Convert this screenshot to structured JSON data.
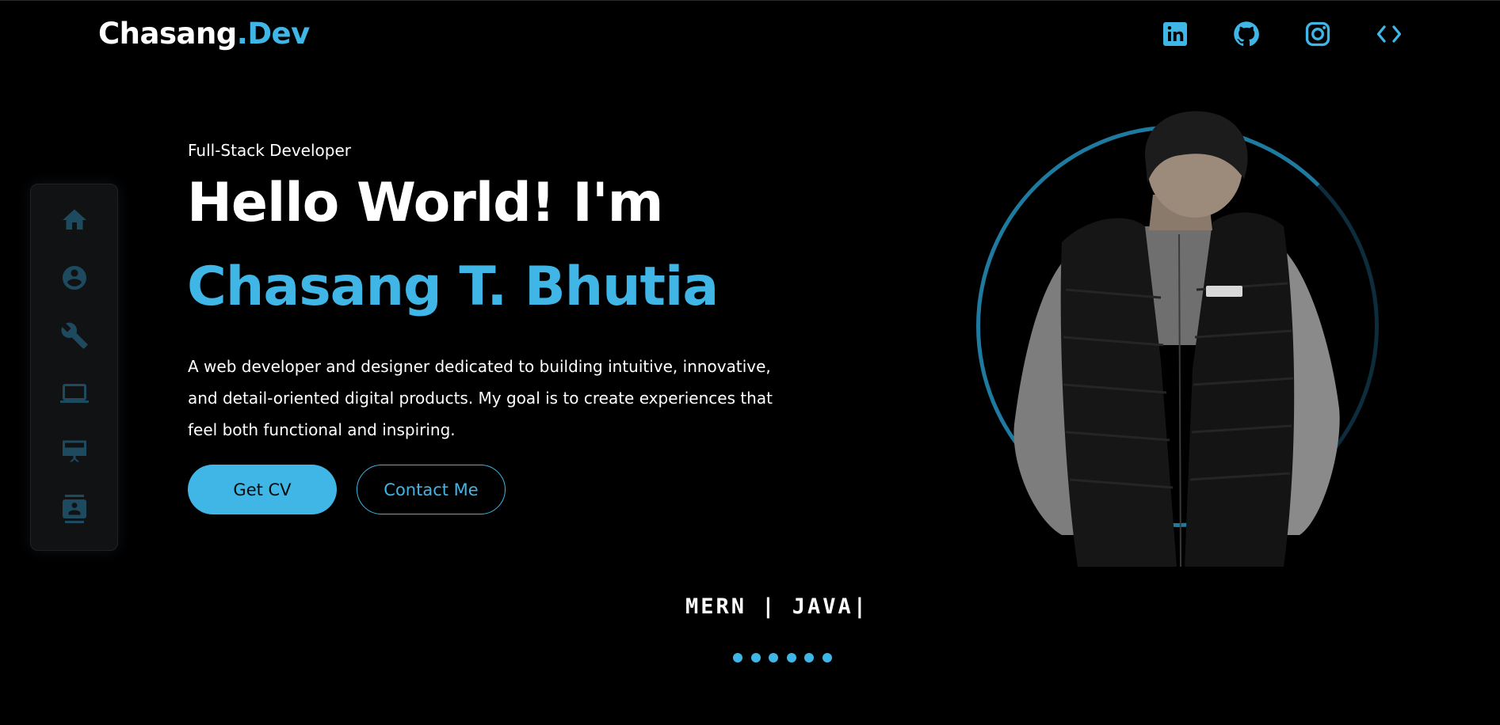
{
  "header": {
    "logo_main": "Chasang",
    "logo_accent": ".Dev",
    "social": [
      {
        "name": "linkedin-icon"
      },
      {
        "name": "github-icon"
      },
      {
        "name": "instagram-icon"
      },
      {
        "name": "code-icon"
      }
    ]
  },
  "sidebar": {
    "items": [
      {
        "icon": "home-icon"
      },
      {
        "icon": "account-circle-icon"
      },
      {
        "icon": "wrench-icon"
      },
      {
        "icon": "laptop-icon"
      },
      {
        "icon": "presentation-icon"
      },
      {
        "icon": "contact-card-icon"
      }
    ]
  },
  "hero": {
    "subtitle": "Full-Stack Developer",
    "greeting": "Hello World! I'm",
    "name": "Chasang T. Bhutia",
    "description": "A web developer and designer dedicated to building intuitive, innovative, and detail-oriented digital products. My goal is to create experiences that feel both functional and inspiring.",
    "cv_button": "Get CV",
    "contact_button": "Contact Me"
  },
  "typing": {
    "text": "MERN | JAVA|"
  },
  "carousel": {
    "dot_count": 6
  },
  "colors": {
    "accent": "#3fb6e6",
    "background": "#000000",
    "sidebar_icon": "#1d4a5e"
  }
}
